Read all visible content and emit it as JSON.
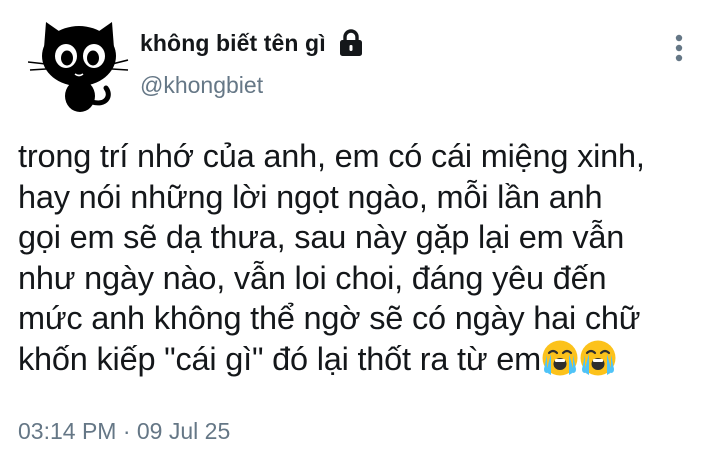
{
  "user": {
    "display_name": "không biết tên gì",
    "handle": "@khongbiet",
    "avatar_icon": "black-cat-icon",
    "protected_icon": "lock-icon"
  },
  "menu": {
    "icon": "more-vertical-icon"
  },
  "tweet": {
    "lines": [
      "trong trí nhớ của anh, em có cái miệng xinh,",
      "hay nói những lời ngọt ngào, mỗi lần anh",
      "gọi em sẽ dạ thưa, sau này gặp lại em vẫn",
      "như ngày nào, vẫn loi choi, đáng yêu đến",
      "mức anh không thể ngờ sẽ có ngày hai chữ",
      "khốn kiếp \"cái gì\" đó lại thốt ra từ em"
    ],
    "trailing_emoji": [
      "loudly-crying-face-emoji",
      "loudly-crying-face-emoji"
    ]
  },
  "meta": {
    "timestamp": "03:14 PM · 09 Jul 25"
  },
  "colors": {
    "text": "#14171a",
    "secondary": "#657786",
    "emoji_face": "#fcc21b",
    "emoji_tears": "#4fc3f7"
  }
}
